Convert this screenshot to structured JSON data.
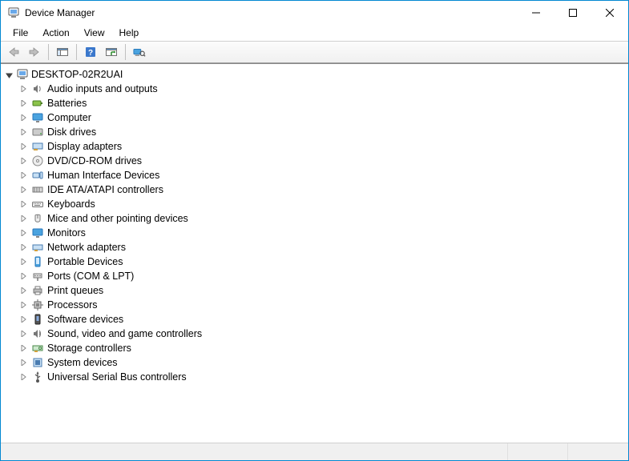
{
  "window": {
    "title": "Device Manager"
  },
  "menu": {
    "items": [
      "File",
      "Action",
      "View",
      "Help"
    ]
  },
  "tree": {
    "root": {
      "label": "DESKTOP-02R2UAI",
      "expanded": true,
      "icon": "computer-icon"
    },
    "categories": [
      {
        "label": "Audio inputs and outputs",
        "icon": "audio-icon"
      },
      {
        "label": "Batteries",
        "icon": "battery-icon"
      },
      {
        "label": "Computer",
        "icon": "monitor-icon"
      },
      {
        "label": "Disk drives",
        "icon": "disk-icon"
      },
      {
        "label": "Display adapters",
        "icon": "display-adapter-icon"
      },
      {
        "label": "DVD/CD-ROM drives",
        "icon": "cdrom-icon"
      },
      {
        "label": "Human Interface Devices",
        "icon": "hid-icon"
      },
      {
        "label": "IDE ATA/ATAPI controllers",
        "icon": "ide-icon"
      },
      {
        "label": "Keyboards",
        "icon": "keyboard-icon"
      },
      {
        "label": "Mice and other pointing devices",
        "icon": "mouse-icon"
      },
      {
        "label": "Monitors",
        "icon": "monitor-icon"
      },
      {
        "label": "Network adapters",
        "icon": "network-icon"
      },
      {
        "label": "Portable Devices",
        "icon": "portable-device-icon"
      },
      {
        "label": "Ports (COM & LPT)",
        "icon": "port-icon"
      },
      {
        "label": "Print queues",
        "icon": "printer-icon"
      },
      {
        "label": "Processors",
        "icon": "cpu-icon"
      },
      {
        "label": "Software devices",
        "icon": "software-device-icon"
      },
      {
        "label": "Sound, video and game controllers",
        "icon": "sound-video-icon"
      },
      {
        "label": "Storage controllers",
        "icon": "storage-controller-icon"
      },
      {
        "label": "System devices",
        "icon": "system-device-icon"
      },
      {
        "label": "Universal Serial Bus controllers",
        "icon": "usb-icon"
      }
    ]
  }
}
